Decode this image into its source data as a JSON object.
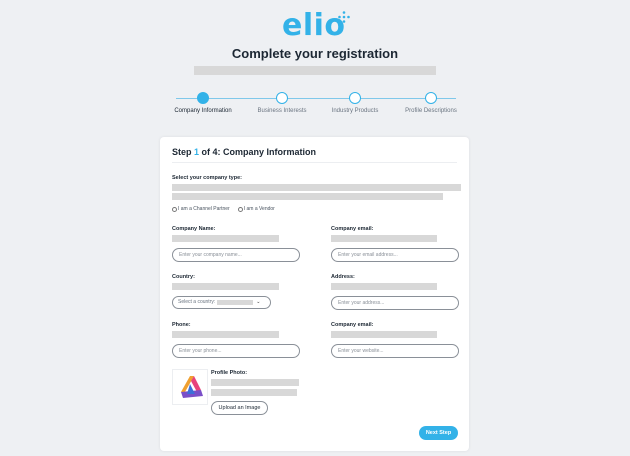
{
  "brand": {
    "logo_text": "elio",
    "accent": "#33b2e8"
  },
  "header": {
    "title": "Complete your registration"
  },
  "stepper": {
    "steps": [
      {
        "label": "Company Information",
        "active": true
      },
      {
        "label": "Business Interests",
        "active": false
      },
      {
        "label": "Industry Products",
        "active": false
      },
      {
        "label": "Profile Descriptions",
        "active": false
      }
    ]
  },
  "card": {
    "title_prefix": "Step ",
    "step_number": "1",
    "title_suffix": " of 4: Company Information",
    "company_type": {
      "label": "Select your company type:",
      "options": [
        "I am a Channel Partner",
        "I am a Vendor"
      ]
    },
    "fields": {
      "company_name": {
        "label": "Company Name:",
        "placeholder": "Enter your company name..."
      },
      "company_email": {
        "label": "Company email:",
        "placeholder": "Enter your email address..."
      },
      "country": {
        "label": "Country:",
        "placeholder": "Select a country:"
      },
      "address": {
        "label": "Address:",
        "placeholder": "Enter your address..."
      },
      "phone": {
        "label": "Phone:",
        "placeholder": "Enter your phone..."
      },
      "website": {
        "label": "Company email:",
        "placeholder": "Enter your website..."
      }
    },
    "profile_photo": {
      "label": "Profile Photo:",
      "upload_label": "Upload an Image"
    },
    "next_label": "Next Step"
  }
}
